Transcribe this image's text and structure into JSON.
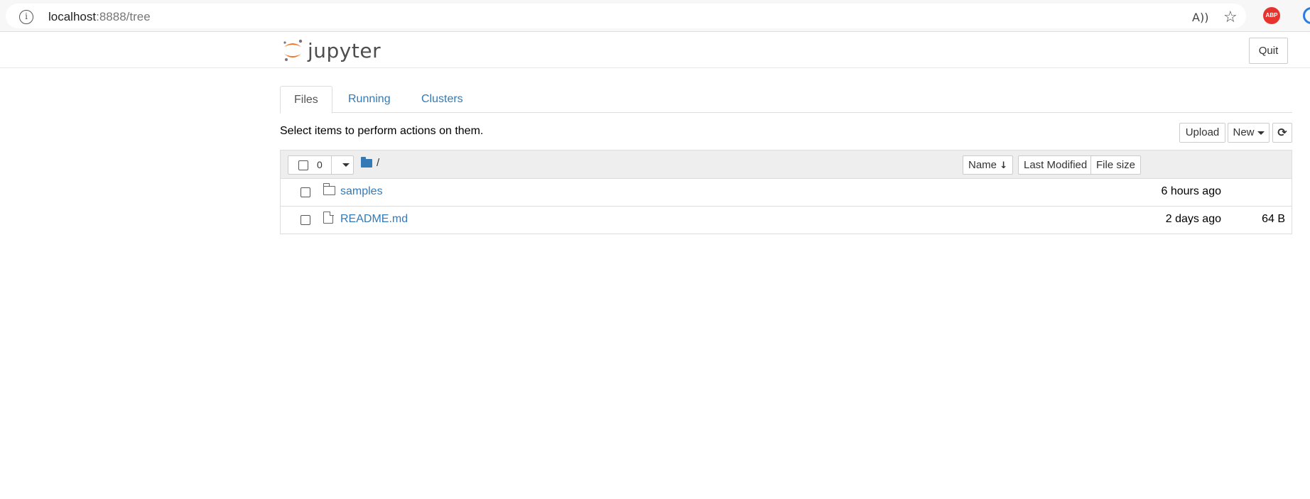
{
  "browser": {
    "url_host": "localhost",
    "url_rest": ":8888/tree",
    "info_icon": "i",
    "read_aloud_icon": "A))",
    "favorites_icon": "☆",
    "abp_label": "ABP"
  },
  "header": {
    "logo_text": "jupyter",
    "quit_label": "Quit",
    "logo_color": "#f37726"
  },
  "tabs": [
    {
      "label": "Files",
      "active": true
    },
    {
      "label": "Running",
      "active": false
    },
    {
      "label": "Clusters",
      "active": false
    }
  ],
  "toolbar": {
    "instructions": "Select items to perform actions on them.",
    "upload_label": "Upload",
    "new_label": "New",
    "refresh_icon": "⟳"
  },
  "list_header": {
    "selected_count": "0",
    "root_path": "/",
    "sort_name": "Name",
    "sort_arrow": "↓",
    "sort_modified": "Last Modified",
    "sort_size": "File size"
  },
  "items": [
    {
      "name": "samples",
      "type": "folder",
      "modified": "6 hours ago",
      "size": ""
    },
    {
      "name": "README.md",
      "type": "file",
      "modified": "2 days ago",
      "size": "64 B"
    }
  ],
  "colors": {
    "link": "#337ab7",
    "accent": "#f37726",
    "abp_red": "#e8322e"
  }
}
